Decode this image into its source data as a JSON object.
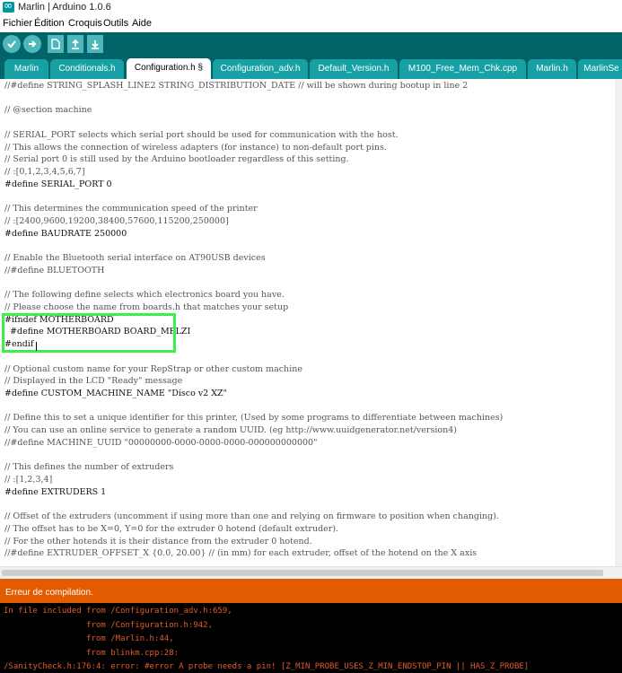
{
  "window": {
    "title": "Marlin | Arduino 1.0.6"
  },
  "menu": {
    "items": [
      "Fichier",
      "Édition",
      "Croquis",
      "Outils",
      "Aide"
    ]
  },
  "toolbar": {
    "icons": [
      "verify-icon",
      "upload-icon",
      "new-icon",
      "open-icon",
      "save-icon"
    ]
  },
  "tabs": [
    {
      "label": "Marlin",
      "active": false
    },
    {
      "label": "Conditionals.h",
      "active": false
    },
    {
      "label": "Configuration.h §",
      "active": true
    },
    {
      "label": "Configuration_adv.h",
      "active": false
    },
    {
      "label": "Default_Version.h",
      "active": false
    },
    {
      "label": "M100_Free_Mem_Chk.cpp",
      "active": false
    },
    {
      "label": "Marlin.h",
      "active": false
    },
    {
      "label": "MarlinSe",
      "active": false
    }
  ],
  "editor": {
    "lines": [
      "//#define STRING_SPLASH_LINE2 STRING_DISTRIBUTION_DATE // will be shown during bootup in line 2",
      "",
      "// @section machine",
      "",
      "// SERIAL_PORT selects which serial port should be used for communication with the host.",
      "// This allows the connection of wireless adapters (for instance) to non-default port pins.",
      "// Serial port 0 is still used by the Arduino bootloader regardless of this setting.",
      "// :[0,1,2,3,4,5,6,7]",
      "#define SERIAL_PORT 0",
      "",
      "// This determines the communication speed of the printer",
      "// :[2400,9600,19200,38400,57600,115200,250000]",
      "#define BAUDRATE 250000",
      "",
      "// Enable the Bluetooth serial interface on AT90USB devices",
      "//#define BLUETOOTH",
      "",
      "// The following define selects which electronics board you have.",
      "// Please choose the name from boards.h that matches your setup",
      "#ifndef MOTHERBOARD",
      "  #define MOTHERBOARD BOARD_MELZI",
      "#endif",
      "",
      "// Optional custom name for your RepStrap or other custom machine",
      "// Displayed in the LCD \"Ready\" message",
      "#define CUSTOM_MACHINE_NAME \"Disco v2 XZ\"",
      "",
      "// Define this to set a unique identifier for this printer, (Used by some programs to differentiate between machines)",
      "// You can use an online service to generate a random UUID. (eg http://www.uuidgenerator.net/version4)",
      "//#define MACHINE_UUID \"00000000-0000-0000-0000-000000000000\"",
      "",
      "// This defines the number of extruders",
      "// :[1,2,3,4]",
      "#define EXTRUDERS 1",
      "",
      "// Offset of the extruders (uncomment if using more than one and relying on firmware to position when changing).",
      "// The offset has to be X=0, Y=0 for the extruder 0 hotend (default extruder).",
      "// For the other hotends it is their distance from the extruder 0 hotend.",
      "//#define EXTRUDER_OFFSET_X {0.0, 20.00} // (in mm) for each extruder, offset of the hotend on the X axis"
    ]
  },
  "status": {
    "message": "Erreur de compilation."
  },
  "console": {
    "lines": [
      "In file included from /Configuration_adv.h:659,",
      "                 from /Configuration.h:942,",
      "                 from /Marlin.h:44,",
      "                 from blinkm.cpp:28:",
      "/SanityCheck.h:176:4: error: #error A probe needs a pin! [Z_MIN_PROBE_USES_Z_MIN_ENDSTOP_PIN || HAS_Z_PROBE]"
    ]
  },
  "colors": {
    "toolbar": "#006468",
    "tab": "#17a1a5",
    "status_error": "#e35b00",
    "console_text": "#e45b2a",
    "highlight": "#3cf04a"
  }
}
